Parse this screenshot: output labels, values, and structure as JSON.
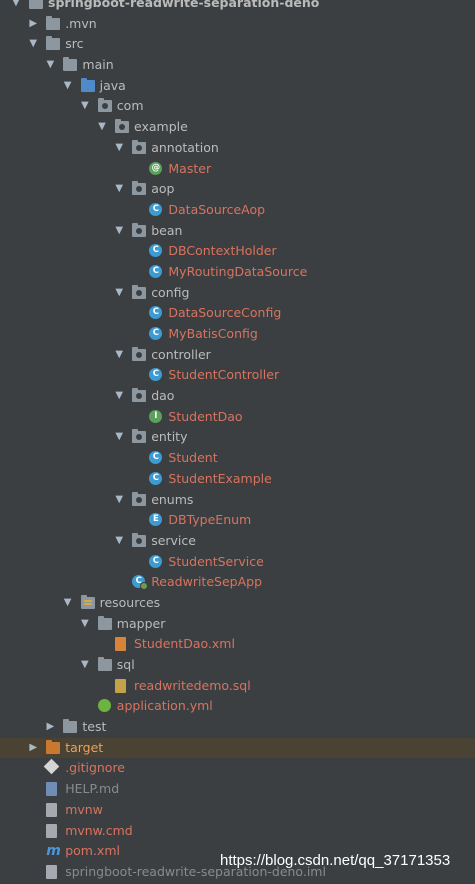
{
  "tree": [
    {
      "label": "springboot-readwrite-separation-deno",
      "depth": 0,
      "arrow": "open",
      "icon": "folder",
      "variant": "root",
      "name": "project-root"
    },
    {
      "label": ".mvn",
      "depth": 1,
      "arrow": "closed",
      "icon": "folder",
      "name": "folder-mvn"
    },
    {
      "label": "src",
      "depth": 1,
      "arrow": "open",
      "icon": "folder",
      "name": "folder-src"
    },
    {
      "label": "main",
      "depth": 2,
      "arrow": "open",
      "icon": "folder",
      "name": "folder-main"
    },
    {
      "label": "java",
      "depth": 3,
      "arrow": "open",
      "icon": "folder-blue",
      "name": "folder-java"
    },
    {
      "label": "com",
      "depth": 4,
      "arrow": "open",
      "icon": "package",
      "name": "package-com"
    },
    {
      "label": "example",
      "depth": 5,
      "arrow": "open",
      "icon": "package",
      "name": "package-example"
    },
    {
      "label": "annotation",
      "depth": 6,
      "arrow": "open",
      "icon": "package",
      "name": "package-annotation"
    },
    {
      "label": "Master",
      "depth": 7,
      "icon": "annotation",
      "variant": "src",
      "name": "file-master"
    },
    {
      "label": "aop",
      "depth": 6,
      "arrow": "open",
      "icon": "package",
      "name": "package-aop"
    },
    {
      "label": "DataSourceAop",
      "depth": 7,
      "icon": "class",
      "variant": "src",
      "name": "file-datasourceaop"
    },
    {
      "label": "bean",
      "depth": 6,
      "arrow": "open",
      "icon": "package",
      "name": "package-bean"
    },
    {
      "label": "DBContextHolder",
      "depth": 7,
      "icon": "class",
      "variant": "src",
      "name": "file-dbcontextholder"
    },
    {
      "label": "MyRoutingDataSource",
      "depth": 7,
      "icon": "class",
      "variant": "src",
      "name": "file-myroutingdatasource"
    },
    {
      "label": "config",
      "depth": 6,
      "arrow": "open",
      "icon": "package",
      "name": "package-config"
    },
    {
      "label": "DataSourceConfig",
      "depth": 7,
      "icon": "class",
      "variant": "src",
      "name": "file-datasourceconfig"
    },
    {
      "label": "MyBatisConfig",
      "depth": 7,
      "icon": "class",
      "variant": "src",
      "name": "file-mybatisconfig"
    },
    {
      "label": "controller",
      "depth": 6,
      "arrow": "open",
      "icon": "package",
      "name": "package-controller"
    },
    {
      "label": "StudentController",
      "depth": 7,
      "icon": "class",
      "variant": "src",
      "name": "file-studentcontroller"
    },
    {
      "label": "dao",
      "depth": 6,
      "arrow": "open",
      "icon": "package",
      "name": "package-dao"
    },
    {
      "label": "StudentDao",
      "depth": 7,
      "icon": "interface",
      "variant": "src",
      "name": "file-studentdao"
    },
    {
      "label": "entity",
      "depth": 6,
      "arrow": "open",
      "icon": "package",
      "name": "package-entity"
    },
    {
      "label": "Student",
      "depth": 7,
      "icon": "class",
      "variant": "src",
      "name": "file-student"
    },
    {
      "label": "StudentExample",
      "depth": 7,
      "icon": "class",
      "variant": "src",
      "name": "file-studentexample"
    },
    {
      "label": "enums",
      "depth": 6,
      "arrow": "open",
      "icon": "package",
      "name": "package-enums"
    },
    {
      "label": "DBTypeEnum",
      "depth": 7,
      "icon": "enum",
      "variant": "src",
      "name": "file-dbtypeenum"
    },
    {
      "label": "service",
      "depth": 6,
      "arrow": "open",
      "icon": "package",
      "name": "package-service"
    },
    {
      "label": "StudentService",
      "depth": 7,
      "icon": "class",
      "variant": "src",
      "name": "file-studentservice"
    },
    {
      "label": "ReadwriteSepApp",
      "depth": 6,
      "icon": "app-class",
      "variant": "src",
      "name": "file-readwritesepapp"
    },
    {
      "label": "resources",
      "depth": 3,
      "arrow": "open",
      "icon": "folder-res",
      "name": "folder-resources"
    },
    {
      "label": "mapper",
      "depth": 4,
      "arrow": "open",
      "icon": "folder",
      "name": "folder-mapper"
    },
    {
      "label": "StudentDao.xml",
      "depth": 5,
      "icon": "xml",
      "variant": "src",
      "name": "file-studentdao-xml"
    },
    {
      "label": "sql",
      "depth": 4,
      "arrow": "open",
      "icon": "folder",
      "name": "folder-sql"
    },
    {
      "label": "readwritedemo.sql",
      "depth": 5,
      "icon": "sql",
      "variant": "src",
      "name": "file-readwritedemo-sql"
    },
    {
      "label": "application.yml",
      "depth": 4,
      "icon": "spring",
      "variant": "src",
      "name": "file-application-yml"
    },
    {
      "label": "test",
      "depth": 2,
      "arrow": "closed",
      "icon": "folder",
      "name": "folder-test"
    },
    {
      "label": "target",
      "depth": 1,
      "arrow": "closed",
      "icon": "folder-orange",
      "variant": "excluded",
      "name": "folder-target"
    },
    {
      "label": ".gitignore",
      "depth": 1,
      "icon": "git",
      "variant": "src",
      "name": "file-gitignore"
    },
    {
      "label": "HELP.md",
      "depth": 1,
      "icon": "md",
      "variant": "grey",
      "name": "file-help-md"
    },
    {
      "label": "mvnw",
      "depth": 1,
      "icon": "mvnfile",
      "variant": "src",
      "name": "file-mvnw"
    },
    {
      "label": "mvnw.cmd",
      "depth": 1,
      "icon": "mvnfile",
      "variant": "src",
      "name": "file-mvnw-cmd"
    },
    {
      "label": "pom.xml",
      "depth": 1,
      "icon": "maven",
      "variant": "src",
      "name": "file-pom-xml"
    },
    {
      "label": "springboot-readwrite-separation-deno.iml",
      "depth": 1,
      "icon": "iml",
      "variant": "grey",
      "name": "file-iml"
    }
  ],
  "watermark": "https://blog.csdn.net/qq_37171353",
  "icons": {
    "arrow_open": "▼",
    "arrow_closed": "▶",
    "maven": "m",
    "class": "C",
    "interface": "I",
    "annotation": "@",
    "enum": "E"
  }
}
